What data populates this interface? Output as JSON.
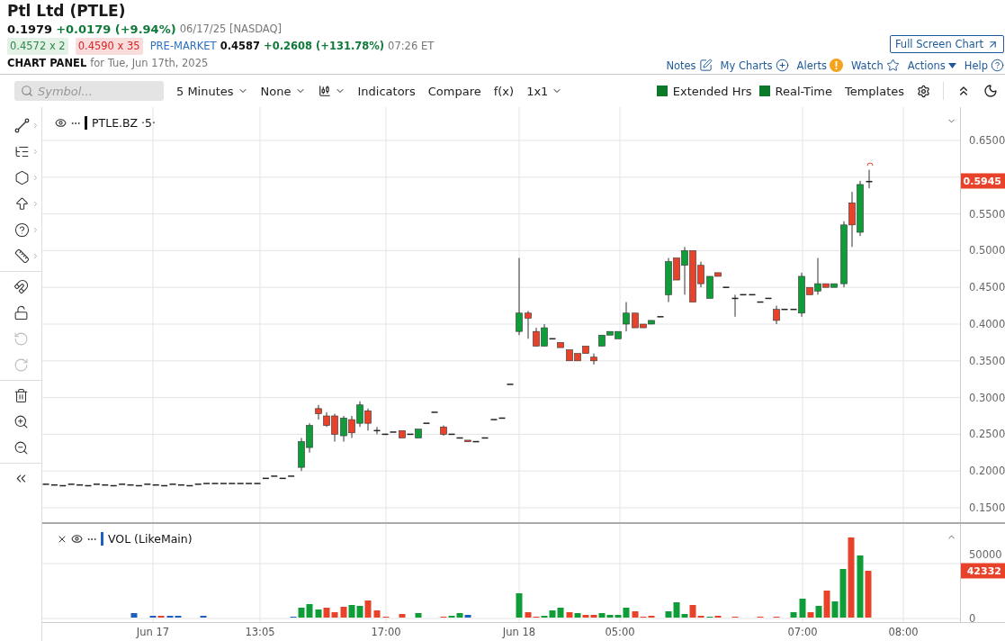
{
  "quote": {
    "title": "Ptl Ltd (PTLE)",
    "last": "0.1979",
    "change": "+0.0179 (+9.94%)",
    "date": "06/17/25 [NASDAQ]",
    "bid": "0.4572 x 2",
    "ask": "0.4590 x 35",
    "session": "PRE-MARKET",
    "session_price": "0.4587",
    "session_change": "+0.2608 (+131.78%)",
    "session_time": "07:26 ET",
    "panel_title": "CHART PANEL",
    "panel_date": "for Tue, Jun 17th, 2025"
  },
  "full_screen_button": "Full Screen Chart",
  "links": [
    {
      "kind": "notes",
      "label": "Notes"
    },
    {
      "kind": "charts",
      "label": "My Charts"
    },
    {
      "kind": "alerts",
      "label": "Alerts"
    },
    {
      "kind": "watch",
      "label": "Watch"
    },
    {
      "kind": "actions",
      "label": "Actions"
    },
    {
      "kind": "help",
      "label": "Help"
    }
  ],
  "toolbar": {
    "search": {
      "placeholder": "Symbol..."
    },
    "dropdowns": [
      {
        "kind": "text",
        "label": "5 Minutes"
      },
      {
        "kind": "text",
        "label": "None"
      },
      {
        "kind": "chart-type"
      }
    ],
    "buttons": [
      "Indicators",
      "Compare",
      "f(x)"
    ],
    "layout": "1x1",
    "toggles": [
      {
        "label": "Extended Hrs",
        "checked": true
      },
      {
        "label": "Real-Time",
        "checked": true
      }
    ],
    "templates": "Templates"
  },
  "drawing_tools": [
    [
      {
        "kind": "line",
        "submenu": true,
        "disabled": false
      },
      {
        "kind": "fib",
        "submenu": true,
        "disabled": false
      },
      {
        "kind": "shape",
        "submenu": true,
        "disabled": false
      },
      {
        "kind": "arrow",
        "submenu": true,
        "disabled": false
      },
      {
        "kind": "help",
        "submenu": true,
        "disabled": false
      },
      {
        "kind": "measure",
        "submenu": true,
        "disabled": false
      }
    ],
    [
      {
        "kind": "magnet",
        "submenu": false,
        "disabled": false
      },
      {
        "kind": "lock",
        "submenu": false,
        "disabled": false
      },
      {
        "kind": "undo",
        "submenu": false,
        "disabled": true
      },
      {
        "kind": "redo",
        "submenu": false,
        "disabled": true
      }
    ],
    [
      {
        "kind": "trash",
        "submenu": false,
        "disabled": false
      },
      {
        "kind": "zoom-in",
        "submenu": false,
        "disabled": false
      },
      {
        "kind": "zoom-out",
        "submenu": false,
        "disabled": false
      }
    ],
    [
      {
        "kind": "collapse",
        "submenu": false,
        "disabled": false
      }
    ]
  ],
  "price_pane": {
    "legend": "PTLE.BZ ·5·",
    "ticks": [
      "0.6500",
      "0.5500",
      "0.5000",
      "0.4500",
      "0.4000",
      "0.3500",
      "0.3000",
      "0.2500",
      "0.2000",
      "0.1500"
    ],
    "current": "0.5945"
  },
  "volume_pane": {
    "legend": "VOL (LikeMain)",
    "ticks": [
      "50000",
      "0"
    ],
    "current": "42332"
  },
  "time_axis": [
    "Jun 17",
    "13:05",
    "17:00",
    "Jun 18",
    "05:00",
    "07:00",
    "08:00"
  ]
}
